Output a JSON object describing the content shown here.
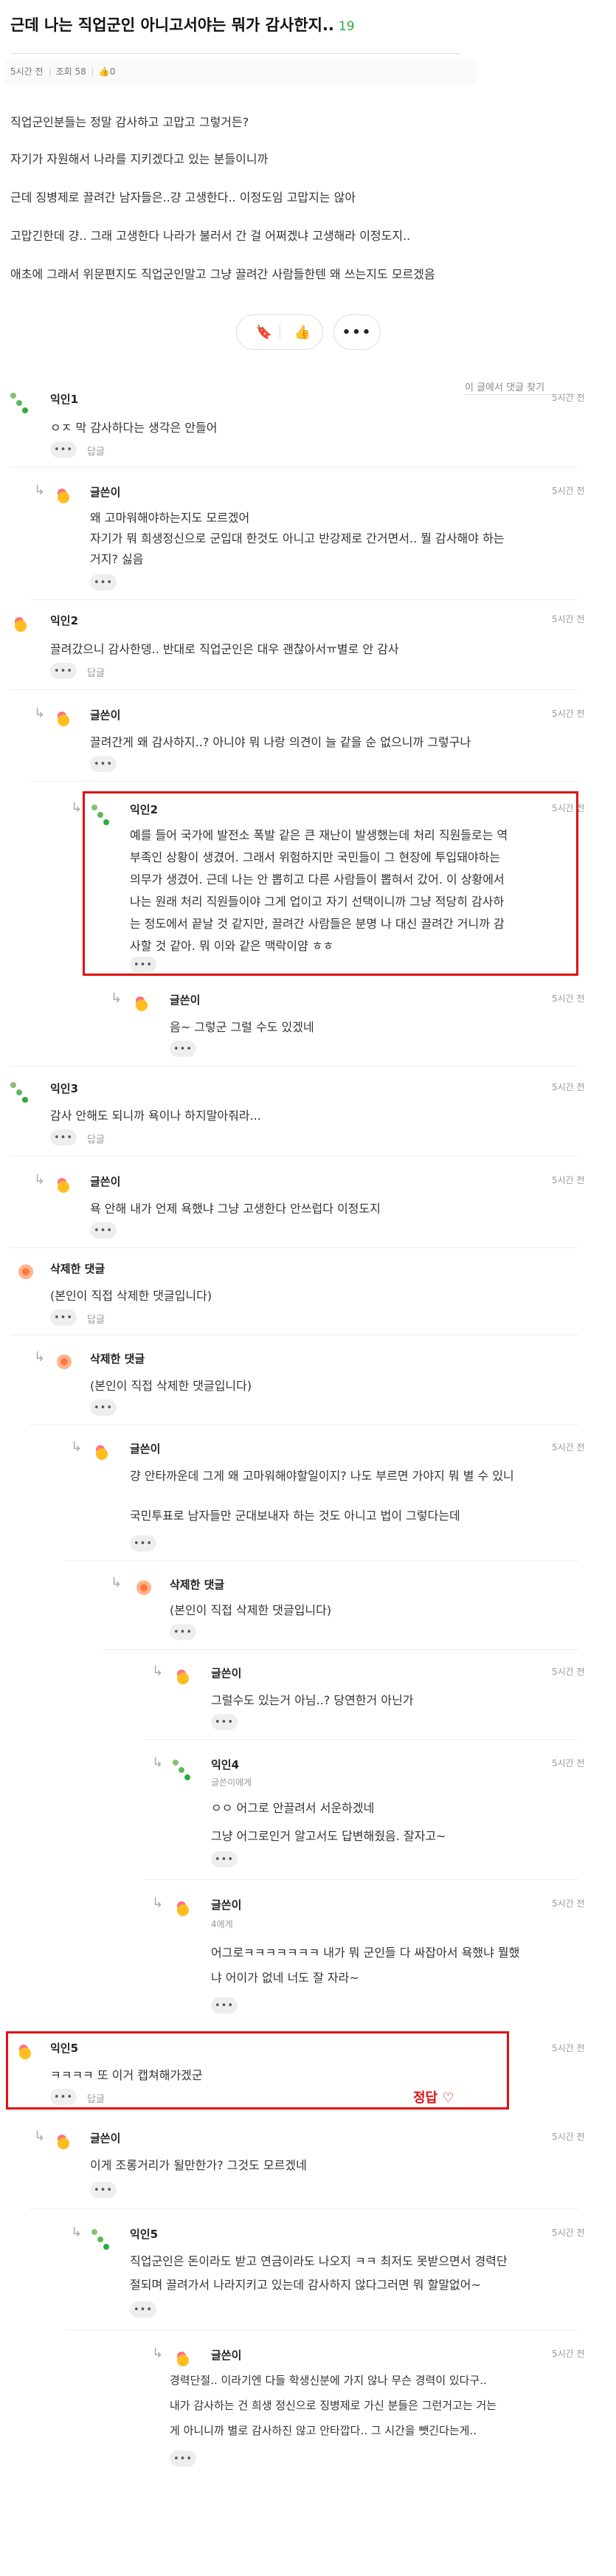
{
  "post": {
    "title": "근데 나는 직업군인 아니고서야는 뭐가 감사한지..",
    "comment_count": "19",
    "time": "5시간 전",
    "views": "조회 58",
    "likes": "0",
    "lines": [
      "직업군인분들는 정말 감사하고 고맙고 그렇거든?",
      "자기가 자원해서 나라를 지키겠다고 있는 분들이니까",
      "근데 징병제로 끌려간 남자들은..걍 고생한다.. 이정도임 고맙지는 않아",
      "고맙긴한데 걍.. 그래 고생한다 나라가 불러서 간 걸 어쩌겠냐 고생해라 이정도지..",
      "애초에 그래서 위문편지도 직업군인말고 그냥 끌려간 사람들한텐 왜 쓰는지도 모르겠음"
    ]
  },
  "actions": {
    "bookmark_icon": "bookmark-icon",
    "like_icon": "thumbs-up-icon",
    "more_label": "•••"
  },
  "find_comment": "이 글에서 댓글 찾기",
  "labels": {
    "more": "•••",
    "reply": "답글",
    "correct": "정답 ♡"
  },
  "colors": {
    "accent_green": "#2eab3e",
    "highlight_red": "#e01010"
  },
  "comments": [
    {
      "name": "익인1",
      "time": "5시간 전",
      "lines": [
        "ㅇㅈ 막 감사하다는 생각은 안들어"
      ]
    },
    {
      "name": "글쓴이",
      "time": "5시간 전",
      "lines": [
        "왜 고마워해야하는지도 모르겠어",
        "자기가 뭐 희생정신으로 군입대 한것도 아니고 반강제로 간거면서.. 뭘 감사해야 하는",
        "거지? 싫음"
      ]
    },
    {
      "name": "익인2",
      "time": "5시간 전",
      "lines": [
        "끌려갔으니 감사한뎅.. 반대로 직업군인은 대우 괜찮아서ㅠ별로 안 감사"
      ]
    },
    {
      "name": "글쓴이",
      "time": "5시간 전",
      "lines": [
        "끌려간게 왜 감사하지..? 아니야 뭐 나랑 의견이 늘 같을 순 없으니까 그렇구나"
      ]
    },
    {
      "name": "익인2",
      "time": "5시간 전",
      "lines": [
        "예를 들어 국가에 발전소 폭발 같은 큰 재난이 발생했는데 처리 직원들로는 역",
        "부족인 상황이 생겼어. 그래서 위험하지만 국민들이 그 현장에 투입돼야하는",
        "의무가 생겼어. 근데 나는 안 뽑히고 다른 사람들이 뽑혀서 갔어. 이 상황에서",
        "나는 원래 처리 직원들이야 그게 업이고 자기 선택이니까 그냥 적당히 감사하",
        "는 정도에서 끝날 것 같지만, 끌려간 사람들은 분명 나 대신 끌려간 거니까 감",
        "사할 것 같아. 뭐 이와 같은 맥락이얌 ㅎㅎ"
      ]
    },
    {
      "name": "글쓴이",
      "time": "5시간 전",
      "lines": [
        "음~ 그렇군 그럴 수도 있겠네"
      ]
    },
    {
      "name": "익인3",
      "time": "5시간 전",
      "lines": [
        "감사 안해도 되니까 욕이나 하지말아줘라..."
      ]
    },
    {
      "name": "글쓴이",
      "time": "5시간 전",
      "lines": [
        "욕 안해 내가 언제 욕했냐 그냥 고생한다 안쓰럽다 이정도지"
      ]
    },
    {
      "name": "삭제한 댓글",
      "lines": [
        "(본인이 직접 삭제한 댓글입니다)"
      ]
    },
    {
      "name": "삭제한 댓글",
      "lines": [
        "(본인이 직접 삭제한 댓글입니다)"
      ]
    },
    {
      "name": "글쓴이",
      "time": "5시간 전",
      "lines": [
        "걍 안타까운데 그게 왜 고마워해야할일이지? 나도 부르면 가야지 뭐 별 수 있니",
        "국민투표로 남자들만 군대보내자 하는 것도 아니고 법이 그렇다는데"
      ]
    },
    {
      "name": "삭제한 댓글",
      "lines": [
        "(본인이 직접 삭제한 댓글입니다)"
      ]
    },
    {
      "name": "글쓴이",
      "time": "5시간 전",
      "lines": [
        "그럴수도 있는거 아님..? 당연한거 아닌가"
      ]
    },
    {
      "name": "익인4",
      "sub": "글쓴이에게",
      "time": "5시간 전",
      "lines": [
        "ㅇㅇ 어그로 안끌려서 서운하겠네",
        "그냥 어그로인거 알고서도 답변해줬음. 잘자고~"
      ]
    },
    {
      "name": "글쓴이",
      "sub": "4에게",
      "time": "5시간 전",
      "lines": [
        "어그로ㅋㅋㅋㅋㅋㅋㅋ 내가 뭐 군인들 다 싸잡아서 욕했냐 뭘했",
        "냐 어이가 없네 너도 잘 자라~"
      ]
    },
    {
      "name": "익인5",
      "time": "5시간 전",
      "lines": [
        "ㅋㅋㅋㅋ 또 이거 캡쳐해가겠군"
      ]
    },
    {
      "name": "글쓴이",
      "time": "5시간 전",
      "lines": [
        "이게 조롱거리가 될만한가? 그것도 모르겠네"
      ]
    },
    {
      "name": "익인5",
      "time": "5시간 전",
      "lines": [
        "직업군인은 돈이라도 받고 연금이라도 나오지 ㅋㅋ 최저도 못받으면서 경력단",
        "절되며 끌려가서 나라지키고 있는데 감사하지 않다그러면 뭐 할말없어~"
      ]
    },
    {
      "name": "글쓴이",
      "time": "5시간 전",
      "lines": [
        "경력단절.. 이라기엔 다들 학생신분에 가지 않나 무슨 경력이 있다구..",
        "내가 감사하는 건 희생 정신으로 징병제로 가신 분들은 그런거고는 거는",
        "게 아니니까 별로 감사하진 않고 안타깝다.. 그 시간을 뺏긴다는게.."
      ]
    }
  ]
}
